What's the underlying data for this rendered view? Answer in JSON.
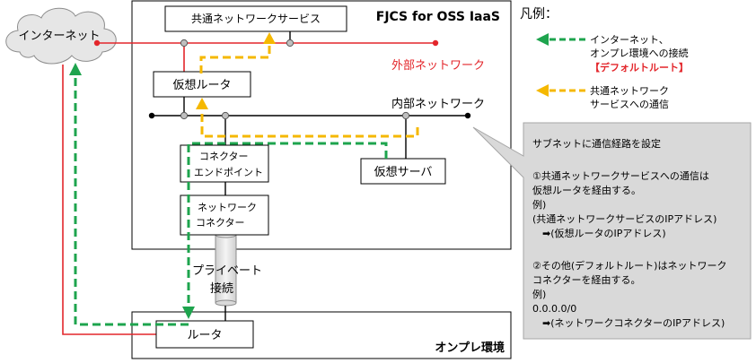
{
  "areas": {
    "iaas_title": "FJCS for OSS IaaS",
    "onpremise_title": "オンプレ環境"
  },
  "cloud": {
    "label": "インターネット"
  },
  "boxes": {
    "shared_service": "共通ネットワークサービス",
    "virtual_router": "仮想ルータ",
    "connector_endpoint": [
      "コネクター",
      "エンドポイント"
    ],
    "network_connector": [
      "ネットワーク",
      "コネクター"
    ],
    "virtual_server": "仮想サーバ",
    "router": "ルータ"
  },
  "networks": {
    "external": "外部ネットワーク",
    "internal": "内部ネットワーク"
  },
  "private_connection": [
    "プライベート",
    "接続"
  ],
  "legend": {
    "title": "凡例：",
    "green_lines": [
      "インターネット、",
      "オンプレ環境への接続"
    ],
    "green_note": "【デフォルトルート】",
    "yellow_lines": [
      "共通ネットワーク",
      "サービスへの通信"
    ]
  },
  "callout": {
    "lines": [
      "サブネットに通信経路を設定",
      "",
      "①共通ネットワークサービスへの通信は",
      "仮想ルータを経由する。",
      "例)",
      "(共通ネットワークサービスのIPアドレス)",
      "　➡(仮想ルータのIPアドレス)",
      "",
      "②その他(デフォルトルート)はネットワーク",
      "コネクターを経由する。",
      "例)",
      "0.0.0.0/0",
      "　➡(ネットワークコネクターのIPアドレス)"
    ]
  },
  "colors": {
    "red": "#e3262b",
    "green": "#1ea44e",
    "yellow": "#f5b800",
    "black": "#000000",
    "callout_bg": "#d9d9d9",
    "cloud_fill": "#e6e6e6",
    "port_fill": "#bfbfbf"
  }
}
